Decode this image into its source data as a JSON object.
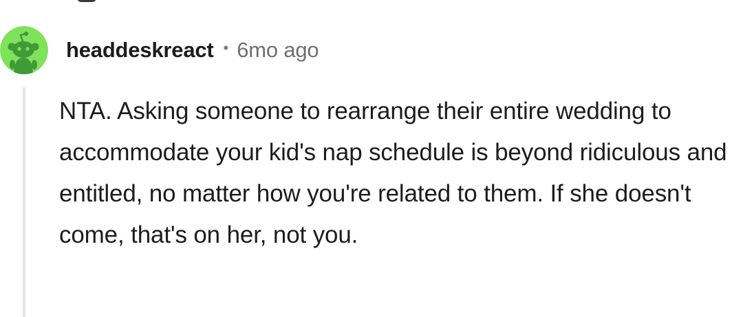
{
  "comment": {
    "author": "headdeskreact",
    "separator": "•",
    "age": "6mo ago",
    "body": "NTA. Asking someone to rearrange their entire wedding to accommodate your kid's nap schedule is beyond ridiculous and entitled, no matter how you're related to them. If she doesn't come, that's on her, not you.",
    "avatar": {
      "icon": "snoo-avatar-icon",
      "background_color": "#7ee35a",
      "figure_color": "#3f9b38"
    }
  }
}
